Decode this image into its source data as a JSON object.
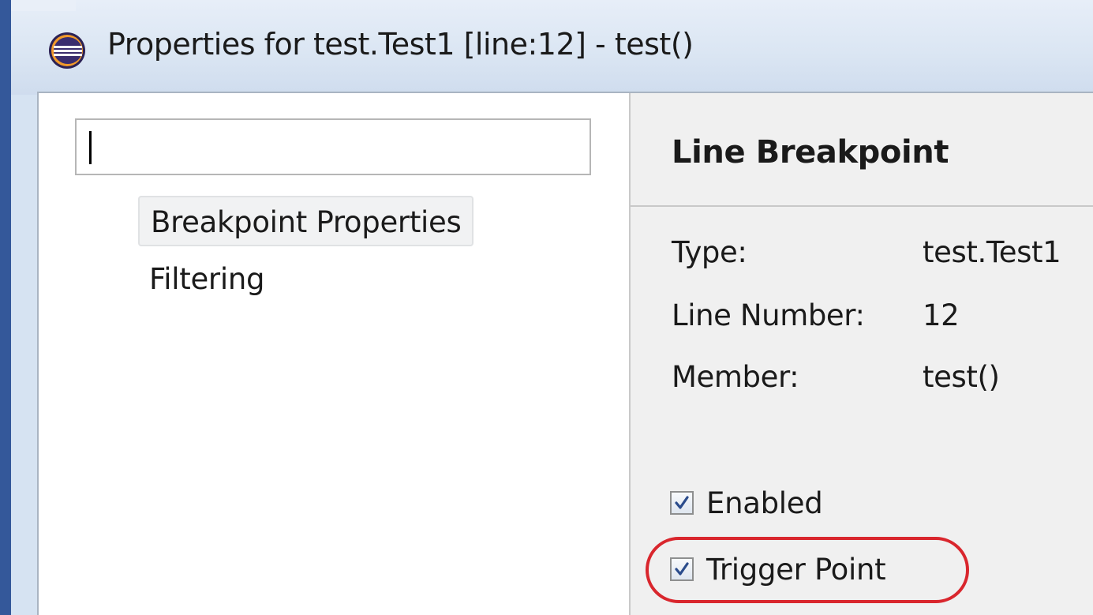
{
  "window": {
    "title": "Properties for test.Test1 [line:12] - test()",
    "app_icon": "eclipse-icon"
  },
  "navigation": {
    "filter_value": "",
    "items": [
      {
        "label": "Breakpoint Properties",
        "selected": true
      },
      {
        "label": "Filtering",
        "selected": false
      }
    ]
  },
  "page": {
    "title": "Line Breakpoint",
    "properties": [
      {
        "label": "Type:",
        "value": "test.Test1"
      },
      {
        "label": "Line Number:",
        "value": "12"
      },
      {
        "label": "Member:",
        "value": "test()"
      }
    ],
    "checkboxes": [
      {
        "label": "Enabled",
        "checked": true,
        "icon": "checkmark-icon"
      },
      {
        "label": "Trigger Point",
        "checked": true,
        "icon": "checkmark-icon",
        "highlighted": true
      }
    ]
  },
  "colors": {
    "highlight_ring": "#d9262d",
    "checkmark": "#2b4c8c",
    "desktop": "#2f5597"
  }
}
